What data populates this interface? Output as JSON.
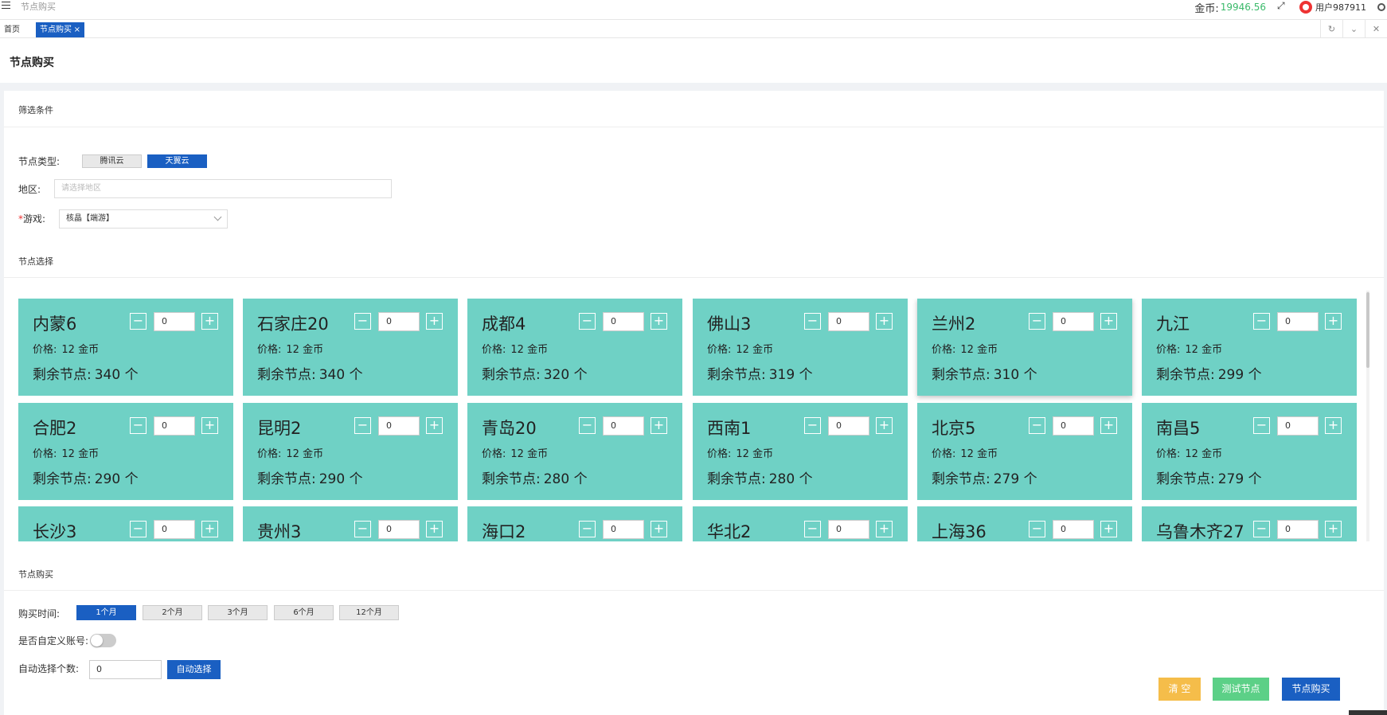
{
  "topbar": {
    "breadcrumb": "节点购买",
    "gold_label": "金币:",
    "gold_value": "19946.56",
    "username": "用户987911"
  },
  "tabs": {
    "home_label": "首页",
    "active_label": "节点购买",
    "close_glyph": "×",
    "refresh_glyph": "↻",
    "dropdown_glyph": "⌄",
    "close_all_glyph": "✕"
  },
  "page": {
    "title": "节点购买"
  },
  "filter": {
    "section_title": "筛选条件",
    "node_type_label": "节点类型:",
    "node_types": [
      "腾讯云",
      "天翼云"
    ],
    "region_label": "地区:",
    "region_placeholder": "请选择地区",
    "game_required_mark": "*",
    "game_label": "游戏:",
    "game_value": "核晶【端游】"
  },
  "node_select": {
    "section_title": "节点选择",
    "price_prefix": "价格:",
    "remain_prefix": "剩余节点:",
    "minus_glyph": "−",
    "plus_glyph": "+",
    "nodes": [
      {
        "name": "内蒙6",
        "price": "12 金币",
        "remain": "340 个",
        "qty": "0"
      },
      {
        "name": "石家庄20",
        "price": "12 金币",
        "remain": "340 个",
        "qty": "0"
      },
      {
        "name": "成都4",
        "price": "12 金币",
        "remain": "320 个",
        "qty": "0"
      },
      {
        "name": "佛山3",
        "price": "12 金币",
        "remain": "319 个",
        "qty": "0"
      },
      {
        "name": "兰州2",
        "price": "12 金币",
        "remain": "310 个",
        "qty": "0"
      },
      {
        "name": "九江",
        "price": "12 金币",
        "remain": "299 个",
        "qty": "0"
      },
      {
        "name": "合肥2",
        "price": "12 金币",
        "remain": "290 个",
        "qty": "0"
      },
      {
        "name": "昆明2",
        "price": "12 金币",
        "remain": "290 个",
        "qty": "0"
      },
      {
        "name": "青岛20",
        "price": "12 金币",
        "remain": "280 个",
        "qty": "0"
      },
      {
        "name": "西南1",
        "price": "12 金币",
        "remain": "280 个",
        "qty": "0"
      },
      {
        "name": "北京5",
        "price": "12 金币",
        "remain": "279 个",
        "qty": "0"
      },
      {
        "name": "南昌5",
        "price": "12 金币",
        "remain": "279 个",
        "qty": "0"
      },
      {
        "name": "长沙3",
        "price": "",
        "remain": "",
        "qty": "0"
      },
      {
        "name": "贵州3",
        "price": "",
        "remain": "",
        "qty": "0"
      },
      {
        "name": "海口2",
        "price": "",
        "remain": "",
        "qty": "0"
      },
      {
        "name": "华北2",
        "price": "",
        "remain": "",
        "qty": "0"
      },
      {
        "name": "上海36",
        "price": "",
        "remain": "",
        "qty": "0"
      },
      {
        "name": "乌鲁木齐27",
        "price": "",
        "remain": "",
        "qty": "0"
      }
    ]
  },
  "purchase": {
    "section_title": "节点购买",
    "duration_label": "购买时间:",
    "durations": [
      "1个月",
      "2个月",
      "3个月",
      "6个月",
      "12个月"
    ],
    "custom_account_label": "是否自定义账号:",
    "auto_count_label": "自动选择个数:",
    "auto_count_value": "0",
    "auto_select_label": "自动选择",
    "clear_label": "清 空",
    "test_label": "测试节点",
    "buy_label": "节点购买"
  },
  "colors": {
    "primary": "#1a5fc2",
    "card": "#6fd1c5",
    "gold": "#3aba6a",
    "clear": "#f5bd4a",
    "test": "#5cd087"
  }
}
